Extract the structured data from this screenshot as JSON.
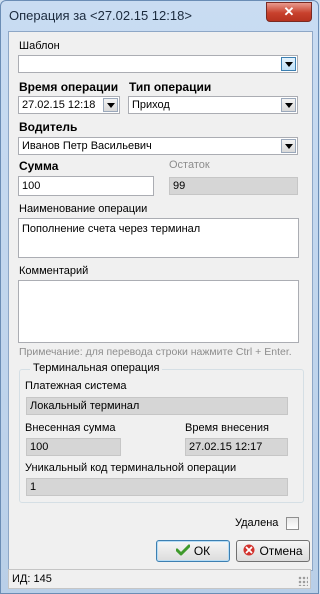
{
  "window": {
    "title": "Операция за <27.02.15 12:18>",
    "close_label": "✕"
  },
  "template": {
    "label": "Шаблон",
    "value": ""
  },
  "operation_time": {
    "label": "Время операции",
    "value": "27.02.15 12:18"
  },
  "operation_type": {
    "label": "Тип операции",
    "value": "Приход"
  },
  "driver": {
    "label": "Водитель",
    "value": "Иванов Петр Васильевич"
  },
  "amount": {
    "label": "Сумма",
    "value": "100"
  },
  "balance": {
    "label": "Остаток",
    "value": "99"
  },
  "operation_name": {
    "label": "Наименование операции",
    "value": "Пополнение счета через терминал"
  },
  "comment": {
    "label": "Комментарий",
    "value": "",
    "note": "Примечание: для перевода строки нажмите Ctrl + Enter."
  },
  "terminal": {
    "title": "Терминальная операция",
    "payment_system_label": "Платежная система",
    "payment_system_value": "Локальный терминал",
    "deposited_amount_label": "Внесенная сумма",
    "deposited_amount_value": "100",
    "deposit_time_label": "Время внесения",
    "deposit_time_value": "27.02.15 12:17",
    "unique_code_label": "Уникальный код терминальной операции",
    "unique_code_value": "1"
  },
  "deleted": {
    "label": "Удалена",
    "checked": false
  },
  "buttons": {
    "ok": "ОК",
    "cancel": "Отмена"
  },
  "status": {
    "text": "ИД: 145"
  },
  "colors": {
    "accent": "#3c7fb1",
    "ok_icon": "#3f9a2c",
    "cancel_icon": "#d2322d",
    "close": "#c8412d"
  },
  "icons": {
    "ok": "check-icon",
    "cancel": "x-icon"
  }
}
